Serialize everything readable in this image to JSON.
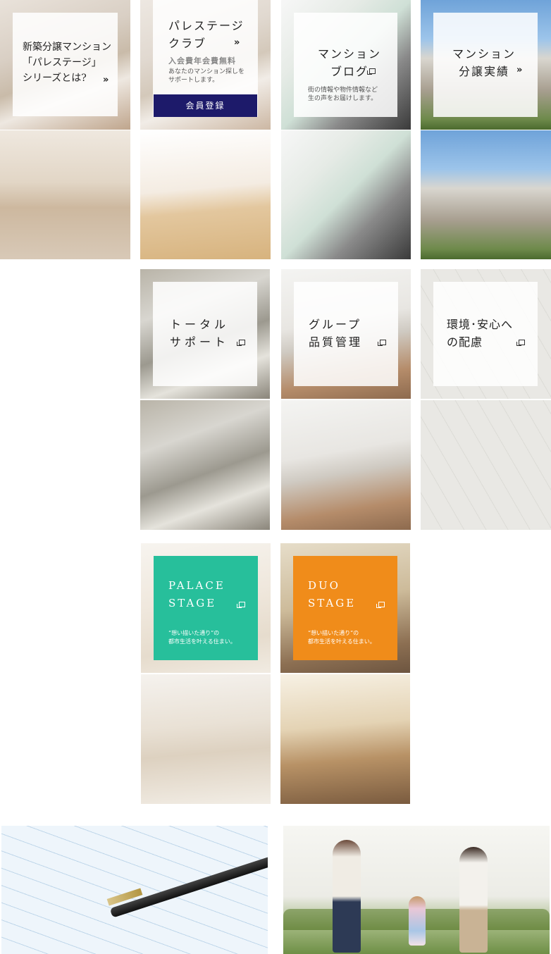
{
  "row1": {
    "new_mansion": {
      "title": "新築分譲マンション\n「パレステージ」\nシリーズとは?",
      "arrow": "»"
    },
    "club": {
      "title": "パレステージ\nクラブ",
      "arrow": "»",
      "fee": "入会費年会費無料",
      "desc": "あなたのマンション探しを\nサポートします。",
      "button": "会員登録"
    },
    "blog": {
      "title": "マンション\nブログ",
      "icon": "external-link-icon",
      "desc": "街の情報や物件情報など\n生の声をお届けします。"
    },
    "results": {
      "title": "マンション\n分譲実績",
      "arrow": "»"
    }
  },
  "row2": {
    "support": {
      "title": "トータル\nサポート",
      "icon": "external-link-icon"
    },
    "quality": {
      "title": "グループ\n品質管理",
      "icon": "external-link-icon"
    },
    "environment": {
      "title": "環境･安心へ\nの配慮",
      "icon": "external-link-icon"
    }
  },
  "row3": {
    "palace": {
      "title": "PALACE\nSTAGE",
      "desc": "“想い描いた通り”の\n都市生活を叶える住まい。",
      "color": "#27bf9b"
    },
    "duo": {
      "title": "DUO\nSTAGE",
      "desc": "“想い描いた通り”の\n都市生活を叶える住まい。",
      "color": "#f08c1a"
    }
  },
  "colors": {
    "button": "#1d1a6a"
  }
}
